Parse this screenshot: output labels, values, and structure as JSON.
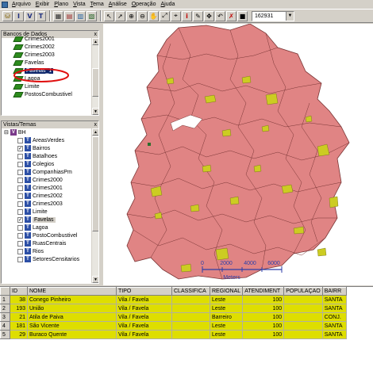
{
  "menu": [
    {
      "ul": "A",
      "rest": "rquivo"
    },
    {
      "ul": "E",
      "rest": "xibir"
    },
    {
      "ul": "P",
      "rest": "lano"
    },
    {
      "ul": "V",
      "rest": "ista"
    },
    {
      "ul": "T",
      "rest": "ema"
    },
    {
      "ul": "A",
      "rest": "nálise"
    },
    {
      "ul": "O",
      "rest": "peração"
    },
    {
      "ul": "A",
      "rest": "juda"
    }
  ],
  "toolbar": {
    "buttons": [
      "db-icon",
      "info-icon",
      "view-icon",
      "theme-icon",
      "grid-icon",
      "graph-icon",
      "legend-icon",
      "table-icon",
      "select-icon",
      "pan-icon",
      "zoom-in-icon",
      "zoom-out-icon",
      "zoom-area-icon",
      "refresh-icon",
      "measure-icon",
      "ruler-icon",
      "info-red-icon",
      "edit-icon",
      "move-icon",
      "undo-icon",
      "delete-icon",
      "stop-icon"
    ],
    "scale_value": "162931"
  },
  "db_panel": {
    "title": "Bancos de Dados",
    "close": "x",
    "items": [
      "Crimes2001",
      "Crimes2002",
      "Crimes2003",
      "Favelas",
      "Favelas_1",
      "Lagoa",
      "Limite",
      "PostosCombustivel"
    ]
  },
  "views_panel": {
    "title": "Vistas/Temas",
    "close": "x",
    "view_name": "BH",
    "themes": [
      {
        "name": "AreasVerdes",
        "checked": false
      },
      {
        "name": "Bairros",
        "checked": true
      },
      {
        "name": "Batalhoes",
        "checked": false
      },
      {
        "name": "Colegios",
        "checked": false
      },
      {
        "name": "CompanhiasPm",
        "checked": false
      },
      {
        "name": "Crimes2000",
        "checked": false
      },
      {
        "name": "Crimes2001",
        "checked": false
      },
      {
        "name": "Crimes2002",
        "checked": false
      },
      {
        "name": "Crimes2003",
        "checked": false
      },
      {
        "name": "Limite",
        "checked": false
      },
      {
        "name": "Favelas",
        "checked": true
      },
      {
        "name": "Lagoa",
        "checked": false
      },
      {
        "name": "PostoCombustivel",
        "checked": false
      },
      {
        "name": "RuasCentrais",
        "checked": false
      },
      {
        "name": "Rios",
        "checked": false
      },
      {
        "name": "SetoresCensitarios",
        "checked": false
      }
    ]
  },
  "map": {
    "scale_labels": [
      "0",
      "2000",
      "4000",
      "6000"
    ],
    "scale_unit": "Meters",
    "colors": {
      "neighborhood": "#e08484",
      "favela": "#cccc22",
      "border": "#7a3535"
    }
  },
  "grid": {
    "headers": [
      "",
      "ID",
      "NOME",
      "TIPO",
      "CLASSIFICA",
      "REGIONAL",
      "ATENDIMENT",
      "POPULAÇAO",
      "BAIRR"
    ],
    "rows": [
      [
        "1",
        "38",
        "Conego Pinheiro",
        "Vila / Favela",
        "",
        "Leste",
        "100",
        "",
        "SANTA"
      ],
      [
        "2",
        "193",
        "União",
        "Vila / Favela",
        "",
        "Leste",
        "100",
        "",
        "SANTA"
      ],
      [
        "3",
        "21",
        "Atila de Paiva",
        "Vila / Favela",
        "",
        "Barreiro",
        "100",
        "",
        "CONJ."
      ],
      [
        "4",
        "181",
        "São Vicente",
        "Vila / Favela",
        "",
        "Leste",
        "100",
        "",
        "SANTA"
      ],
      [
        "5",
        "29",
        "Buraco Quente",
        "Vila / Favela",
        "",
        "Leste",
        "100",
        "",
        "SANTA"
      ]
    ]
  }
}
